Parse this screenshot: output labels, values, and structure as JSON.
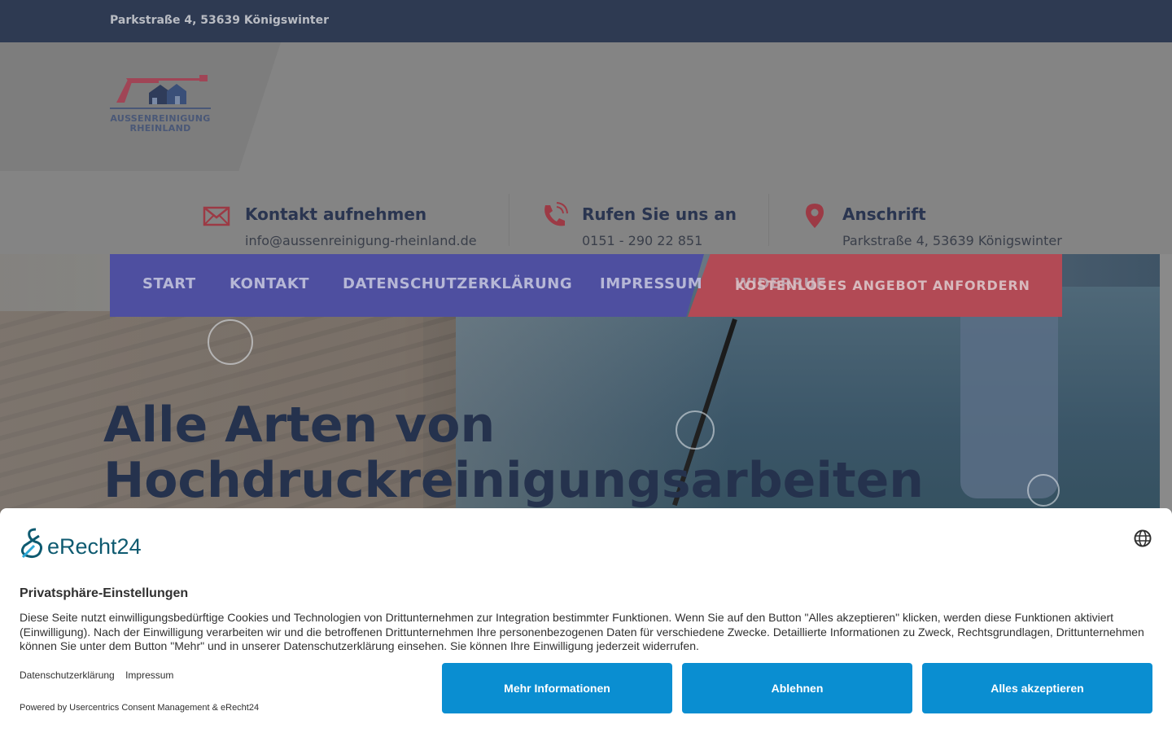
{
  "topbar": {
    "address": "Parkstraße 4, 53639 Königswinter"
  },
  "logo": {
    "line1": "AUSSENREINIGUNG",
    "line2": "RHEINLAND"
  },
  "contacts": [
    {
      "icon": "mail-icon",
      "title": "Kontakt aufnehmen",
      "sub": "info@aussenreinigung-rheinland.de"
    },
    {
      "icon": "phone-icon",
      "title": "Rufen Sie uns an",
      "sub": "0151 - 290 22 851"
    },
    {
      "icon": "location-pin-icon",
      "title": "Anschrift",
      "sub": "Parkstraße 4, 53639 Königswinter"
    }
  ],
  "nav": {
    "items": [
      "START",
      "KONTAKT",
      "DATENSCHUTZERKLÄRUNG",
      "IMPRESSUM",
      "WIDERRUF"
    ],
    "cta": "KOSTENLOSES ANGEBOT ANFORDERN"
  },
  "hero": {
    "line1": "Alle Arten von",
    "line2": "Hochdruckreinigungsarbeiten"
  },
  "consent": {
    "brand": "eRecht24",
    "heading": "Privatsphäre-Einstellungen",
    "description": "Diese Seite nutzt einwilligungsbedürftige Cookies und Technologien von Drittunternehmen zur Integration bestimmter Funktionen. Wenn Sie auf den Button \"Alles akzeptieren\" klicken, werden diese Funktionen aktiviert (Einwilligung). Nach der Einwilligung verarbeiten wir und die betroffenen Drittunternehmen Ihre personenbezogenen Daten für verschiedene Zwecke. Detaillierte Informationen zu Zweck, Rechtsgrundlagen, Drittunternehmen können Sie unter dem Button \"Mehr\" und in unserer Datenschutzerklärung einsehen. Sie können Ihre Einwilligung jederzeit widerrufen.",
    "link_privacy": "Datenschutzerklärung",
    "link_imprint": "Impressum",
    "powered": "Powered by Usercentrics Consent Management & eRecht24",
    "btn_more": "Mehr Informationen",
    "btn_decline": "Ablehnen",
    "btn_accept": "Alles akzeptieren"
  },
  "colors": {
    "topbar": "#2e3a52",
    "nav_blue": "#4e4fa0",
    "nav_red": "#b24a55",
    "hero_title": "#25324d",
    "button": "#0a8ed1"
  }
}
